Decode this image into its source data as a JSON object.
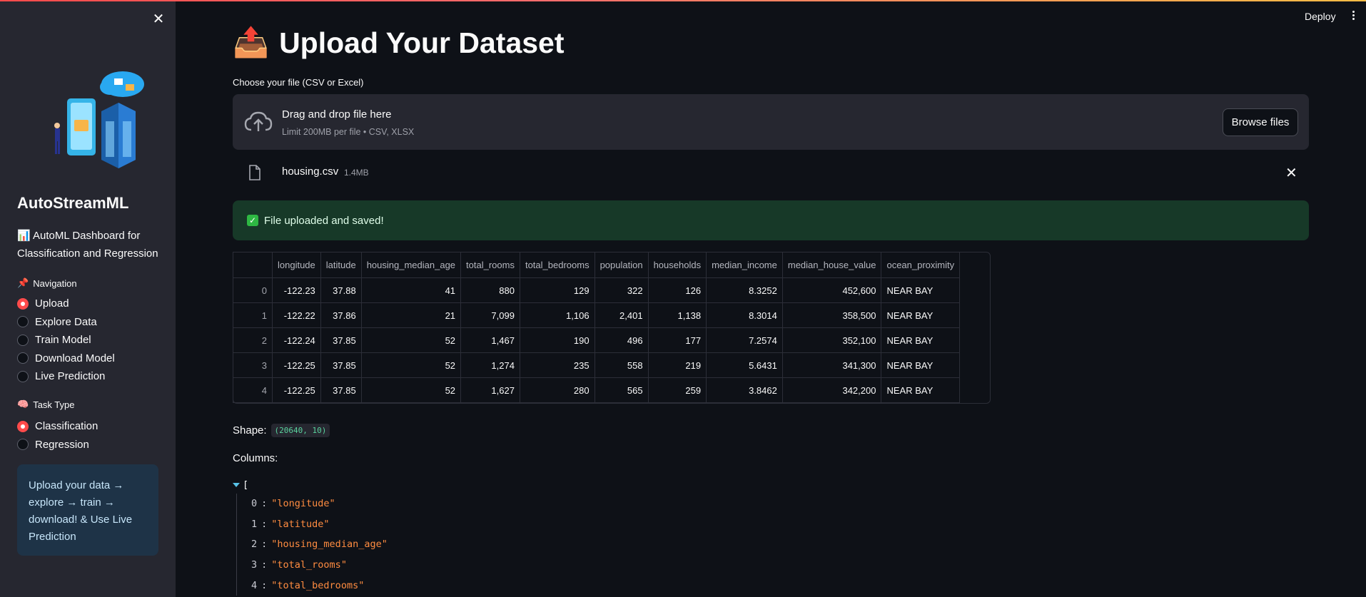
{
  "colors": {
    "accent": "#ff4b4b",
    "sidebar_bg": "#262730",
    "page_bg": "#0e1117",
    "success_bg": "#173928",
    "info_bg": "#1e3347",
    "json_string": "#ff8c40"
  },
  "header": {
    "deploy_label": "Deploy"
  },
  "sidebar": {
    "brand": "AutoStreamML",
    "tagline_icon": "📊",
    "tagline": "AutoML Dashboard for Classification and Regression",
    "navigation": {
      "icon": "📌",
      "label": "Navigation",
      "options": [
        "Upload",
        "Explore Data",
        "Train Model",
        "Download Model",
        "Live Prediction"
      ],
      "selected": "Upload"
    },
    "task_type": {
      "icon": "🧠",
      "label": "Task Type",
      "options": [
        "Classification",
        "Regression"
      ],
      "selected": "Classification"
    },
    "info": "Upload your data → explore → train → download! & Use Live Prediction"
  },
  "main": {
    "title_icon": "📤",
    "title": "Upload Your Dataset",
    "uploader": {
      "label": "Choose your file (CSV or Excel)",
      "drop_text": "Drag and drop file here",
      "limit_text": "Limit 200MB per file • CSV, XLSX",
      "browse_label": "Browse files",
      "file_name": "housing.csv",
      "file_size": "1.4MB"
    },
    "success_icon": "✓",
    "success_text": "File uploaded and saved!",
    "table": {
      "columns": [
        "",
        "longitude",
        "latitude",
        "housing_median_age",
        "total_rooms",
        "total_bedrooms",
        "population",
        "households",
        "median_income",
        "median_house_value",
        "ocean_proximity"
      ],
      "rows": [
        [
          "0",
          "-122.23",
          "37.88",
          "41",
          "880",
          "129",
          "322",
          "126",
          "8.3252",
          "452,600",
          "NEAR BAY"
        ],
        [
          "1",
          "-122.22",
          "37.86",
          "21",
          "7,099",
          "1,106",
          "2,401",
          "1,138",
          "8.3014",
          "358,500",
          "NEAR BAY"
        ],
        [
          "2",
          "-122.24",
          "37.85",
          "52",
          "1,467",
          "190",
          "496",
          "177",
          "7.2574",
          "352,100",
          "NEAR BAY"
        ],
        [
          "3",
          "-122.25",
          "37.85",
          "52",
          "1,274",
          "235",
          "558",
          "219",
          "5.6431",
          "341,300",
          "NEAR BAY"
        ],
        [
          "4",
          "-122.25",
          "37.85",
          "52",
          "1,627",
          "280",
          "565",
          "259",
          "3.8462",
          "342,200",
          "NEAR BAY"
        ]
      ]
    },
    "shape_label": "Shape:",
    "shape_value": "(20640, 10)",
    "columns_label": "Columns:",
    "json_open": "[",
    "json_items": [
      {
        "index": "0",
        "value": "\"longitude\""
      },
      {
        "index": "1",
        "value": "\"latitude\""
      },
      {
        "index": "2",
        "value": "\"housing_median_age\""
      },
      {
        "index": "3",
        "value": "\"total_rooms\""
      },
      {
        "index": "4",
        "value": "\"total_bedrooms\""
      }
    ]
  }
}
